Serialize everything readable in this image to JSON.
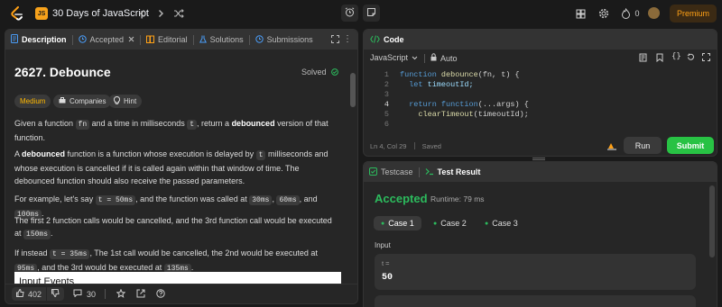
{
  "topbar": {
    "list_title": "30 Days of JavaScript",
    "js_badge": "JS",
    "streak_count": "0",
    "premium_label": "Premium"
  },
  "description_panel": {
    "tabs": [
      {
        "label": "Description"
      },
      {
        "label": "Accepted"
      },
      {
        "label": "Editorial"
      },
      {
        "label": "Solutions"
      },
      {
        "label": "Submissions"
      }
    ],
    "title": "2627. Debounce",
    "solved_label": "Solved",
    "chips": {
      "difficulty": "Medium",
      "companies": "Companies",
      "hint": "Hint"
    },
    "p1": {
      "a": "Given a function ",
      "fn": "fn",
      "b": " and a time in milliseconds ",
      "t": "t",
      "c": ", return a ",
      "bold": "debounced",
      "d": " version of that function."
    },
    "p2": {
      "a": "A ",
      "bold": "debounced",
      "b": " function is a function whose execution is delayed by ",
      "t": "t",
      "c": " milliseconds and whose execution is cancelled if it is called again within that window of time. The debounced function should also receive the passed parameters."
    },
    "p3": {
      "a": "For example, let's say ",
      "t50": "t = 50ms",
      "b": ", and the function was called at ",
      "v30": "30ms",
      "c": ", ",
      "v60": "60ms",
      "d": ", and ",
      "v100": "100ms",
      "e": "."
    },
    "p4": {
      "a": "The first 2 function calls would be cancelled, and the 3rd function call would be executed at ",
      "v150": "150ms",
      "b": "."
    },
    "p5": {
      "a": "If instead ",
      "t35": "t = 35ms",
      "b": ", The 1st call would be cancelled, the 2nd would be executed at ",
      "v95": "95ms",
      "c": ", and the 3rd would be executed at ",
      "v135": "135ms",
      "d": "."
    },
    "input_events_heading": "Input Events",
    "footer": {
      "likes": "402",
      "comments": "30"
    }
  },
  "code_panel": {
    "title": "Code",
    "language": "JavaScript",
    "mode": "Auto",
    "lines": [
      {
        "num": "1",
        "kw": "function ",
        "fn": "debounce",
        "rest": "(fn, t) {"
      },
      {
        "num": "2",
        "kw": "  let ",
        "fn": "",
        "rest": "timeoutId;"
      },
      {
        "num": "3",
        "kw": "",
        "fn": "",
        "rest": ""
      },
      {
        "num": "4",
        "kw": "  return function",
        "fn": "",
        "rest": "(...args) {"
      },
      {
        "num": "5",
        "kw": "    ",
        "fn": "clearTimeout",
        "rest": "(timeoutId);"
      },
      {
        "num": "6",
        "kw": "",
        "fn": "",
        "rest": ""
      }
    ],
    "status": "Ln 4, Col 29",
    "saved": "Saved",
    "run_label": "Run",
    "submit_label": "Submit"
  },
  "result_panel": {
    "tab_testcase": "Testcase",
    "tab_result": "Test Result",
    "verdict": "Accepted",
    "runtime": "Runtime: 79 ms",
    "cases": [
      "Case 1",
      "Case 2",
      "Case 3"
    ],
    "input_label": "Input",
    "param_name": "t =",
    "param_value": "50"
  },
  "colors": {
    "accent_green": "#2cbb5d",
    "brand_orange": "#ffa116",
    "submit_green": "#28c244"
  }
}
